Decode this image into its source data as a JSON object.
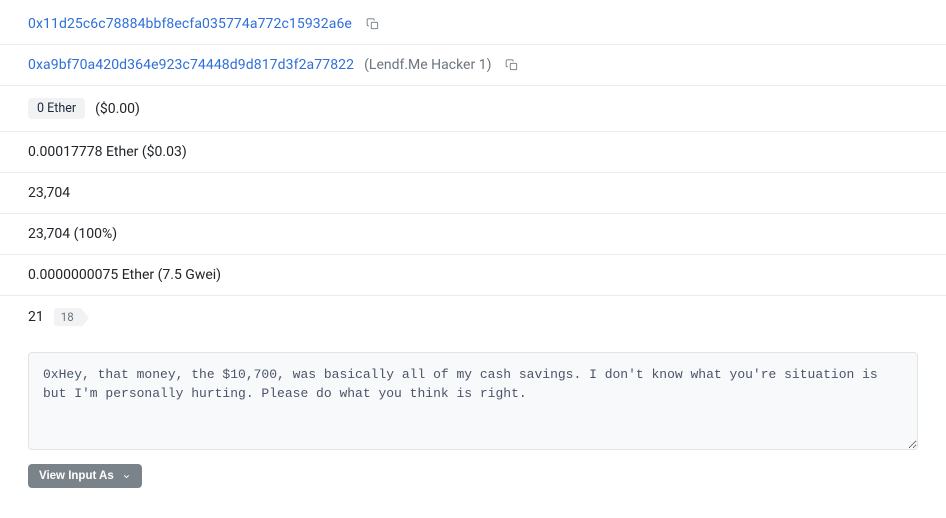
{
  "rows": {
    "from_address": "0x11d25c6c78884bbf8ecfa035774a772c15932a6e",
    "to_address": "0xa9bf70a420d364e923c74448d9d817d3f2a77822",
    "to_address_label": "(Lendf.Me Hacker 1)",
    "value_badge": "0 Ether",
    "value_usd": "($0.00)",
    "transaction_fee": "0.00017778 Ether ($0.03)",
    "gas_limit": "23,704",
    "gas_used": "23,704 (100%)",
    "gas_price": "0.0000000075 Ether (7.5 Gwei)",
    "nonce": "21",
    "nonce_position": "18"
  },
  "input_data": "0xHey, that money, the $10,700, was basically all of my cash savings. I don't know what you're situation is but I'm personally hurting. Please do what you think is right.",
  "buttons": {
    "view_input_as": "View Input As"
  }
}
